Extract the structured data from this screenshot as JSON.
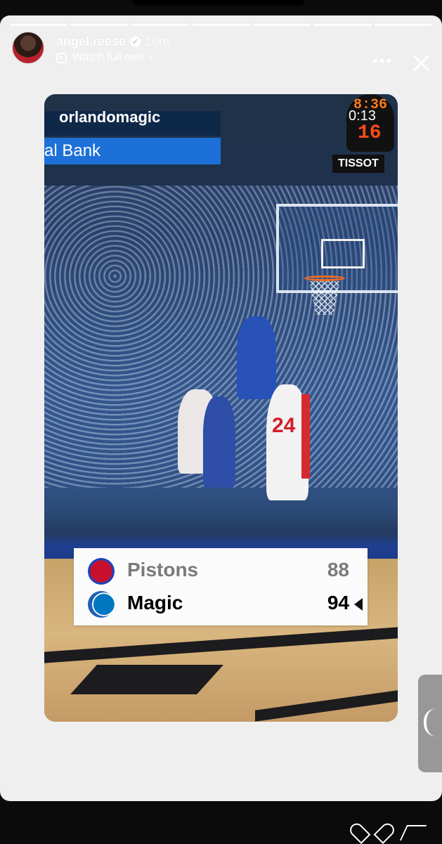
{
  "story": {
    "username": "angel.reese",
    "verified_label": "✓",
    "time": "10m",
    "watch_reel": "Watch full reel",
    "watch_reel_chevron": "›",
    "more_icon": "•••",
    "close_icon": "close-icon"
  },
  "reel": {
    "handle": "orlandomagic",
    "timestamp": "0:13",
    "banner_text": "al Bank",
    "clock_top": "8:36",
    "clock_bottom": "16",
    "sponsor": "TISSOT",
    "jersey_number": "24"
  },
  "scoreboard": {
    "teams": [
      {
        "name": "Pistons",
        "score": "88"
      },
      {
        "name": "Magic",
        "score": "94"
      }
    ]
  },
  "colors": {
    "pistons": "#c8102e",
    "magic": "#0077c0",
    "story_background": "#efefef"
  },
  "icons": {
    "reel_icon": "reel-icon",
    "heart_icon": "heart-icon",
    "send_icon": "send-icon",
    "side_chevron_icon": "chevron-left-icon"
  }
}
